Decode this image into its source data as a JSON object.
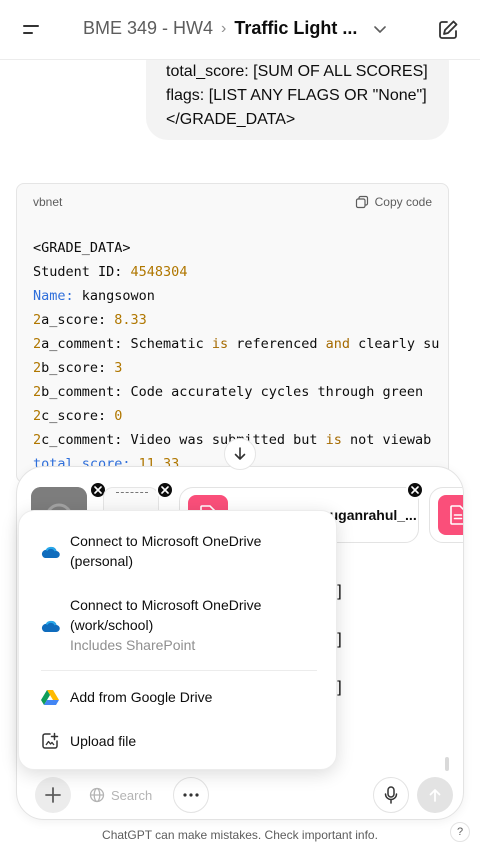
{
  "header": {
    "project": "BME 349 - HW4",
    "chat_title": "Traffic Light ..."
  },
  "user_message": {
    "lines": [
      "total_score: [SUM OF ALL SCORES]",
      "flags: [LIST ANY FLAGS OR \"None\"]",
      "</GRADE_DATA>"
    ]
  },
  "code_block": {
    "language": "vbnet",
    "copy_label": "Copy code",
    "lines": [
      "<GRADE_DATA>",
      "Student ID: 4548304",
      "Name: kangsowon",
      "2a_score: 8.33",
      "2a_comment: Schematic is referenced and clearly su",
      "2b_score: 3",
      "2b_comment: Code accurately cycles through green",
      "2c_score: 0",
      "2c_comment: Video was submitted but is not viewab",
      "total_score: 11.33"
    ]
  },
  "attachments": {
    "file_name": "rajaduraimuruganrahul_..."
  },
  "background_lines": [
    "CK]",
    "CK]",
    "CK]"
  ],
  "menu": {
    "items": [
      {
        "label_line1": "Connect to Microsoft OneDrive",
        "label_line2": "(personal)",
        "icon": "onedrive-icon"
      },
      {
        "label_line1": "Connect to Microsoft OneDrive",
        "label_line2": "(work/school)",
        "sublabel": "Includes SharePoint",
        "icon": "onedrive-icon"
      },
      {
        "label": "Add from Google Drive",
        "icon": "google-drive-icon"
      },
      {
        "label": "Upload file",
        "icon": "upload-file-icon"
      }
    ]
  },
  "toolbar": {
    "search_label": "Search"
  },
  "footer": {
    "disclaimer": "ChatGPT can make mistakes. Check important info.",
    "help_label": "?"
  },
  "colors": {
    "accent_pink": "#fa4f7a",
    "onedrive_blue": "#0f6cbd"
  }
}
